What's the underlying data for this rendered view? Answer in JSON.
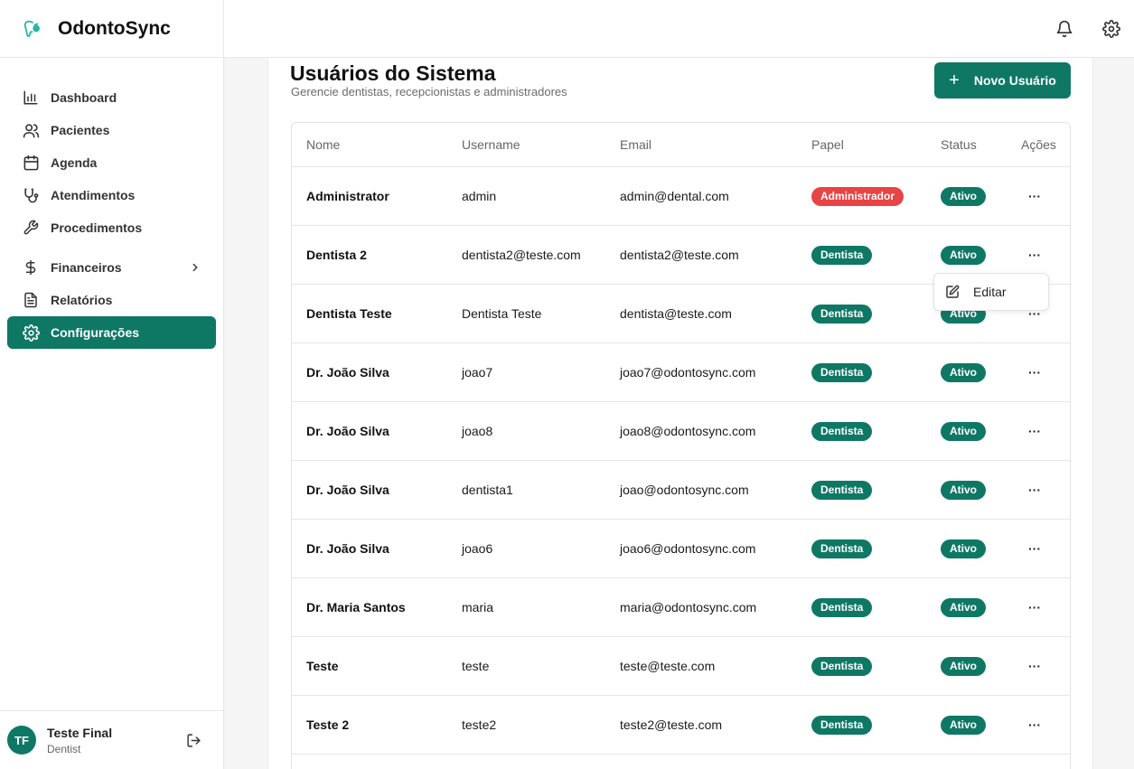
{
  "app": {
    "name": "OdontoSync"
  },
  "sidebar": {
    "items": [
      {
        "label": "Dashboard",
        "icon": "bar-chart-icon"
      },
      {
        "label": "Pacientes",
        "icon": "users-icon"
      },
      {
        "label": "Agenda",
        "icon": "calendar-icon"
      },
      {
        "label": "Atendimentos",
        "icon": "stethoscope-icon"
      },
      {
        "label": "Procedimentos",
        "icon": "wrench-icon"
      },
      {
        "label": "Financeiros",
        "icon": "dollar-icon"
      },
      {
        "label": "Relatórios",
        "icon": "file-text-icon"
      },
      {
        "label": "Configurações",
        "icon": "gear-icon",
        "active": true
      }
    ],
    "user": {
      "initials": "TF",
      "name": "Teste Final",
      "role": "Dentist"
    }
  },
  "page": {
    "title": "Usuários do Sistema",
    "subtitle": "Gerencie dentistas, recepcionistas e administradores",
    "new_button": "Novo Usuário"
  },
  "table": {
    "headers": {
      "nome": "Nome",
      "username": "Username",
      "email": "Email",
      "papel": "Papel",
      "status": "Status",
      "acoes": "Ações"
    },
    "rows": [
      {
        "nome": "Administrator",
        "username": "admin",
        "email": "admin@dental.com",
        "papel": "Administrador",
        "status": "Ativo"
      },
      {
        "nome": "Dentista 2",
        "username": "dentista2@teste.com",
        "email": "dentista2@teste.com",
        "papel": "Dentista",
        "status": "Ativo"
      },
      {
        "nome": "Dentista Teste",
        "username": "Dentista Teste",
        "email": "dentista@teste.com",
        "papel": "Dentista",
        "status": "Ativo"
      },
      {
        "nome": "Dr. João Silva",
        "username": "joao7",
        "email": "joao7@odontosync.com",
        "papel": "Dentista",
        "status": "Ativo"
      },
      {
        "nome": "Dr. João Silva",
        "username": "joao8",
        "email": "joao8@odontosync.com",
        "papel": "Dentista",
        "status": "Ativo"
      },
      {
        "nome": "Dr. João Silva",
        "username": "dentista1",
        "email": "joao@odontosync.com",
        "papel": "Dentista",
        "status": "Ativo"
      },
      {
        "nome": "Dr. João Silva",
        "username": "joao6",
        "email": "joao6@odontosync.com",
        "papel": "Dentista",
        "status": "Ativo"
      },
      {
        "nome": "Dr. Maria Santos",
        "username": "maria",
        "email": "maria@odontosync.com",
        "papel": "Dentista",
        "status": "Ativo"
      },
      {
        "nome": "Teste",
        "username": "teste",
        "email": "teste@teste.com",
        "papel": "Dentista",
        "status": "Ativo"
      },
      {
        "nome": "Teste 2",
        "username": "teste2",
        "email": "teste2@teste.com",
        "papel": "Dentista",
        "status": "Ativo"
      }
    ],
    "actions_label": "···"
  },
  "dropdown": {
    "edit_label": "Editar"
  },
  "colors": {
    "primary": "#0f7865",
    "admin_badge": "#e84445"
  }
}
